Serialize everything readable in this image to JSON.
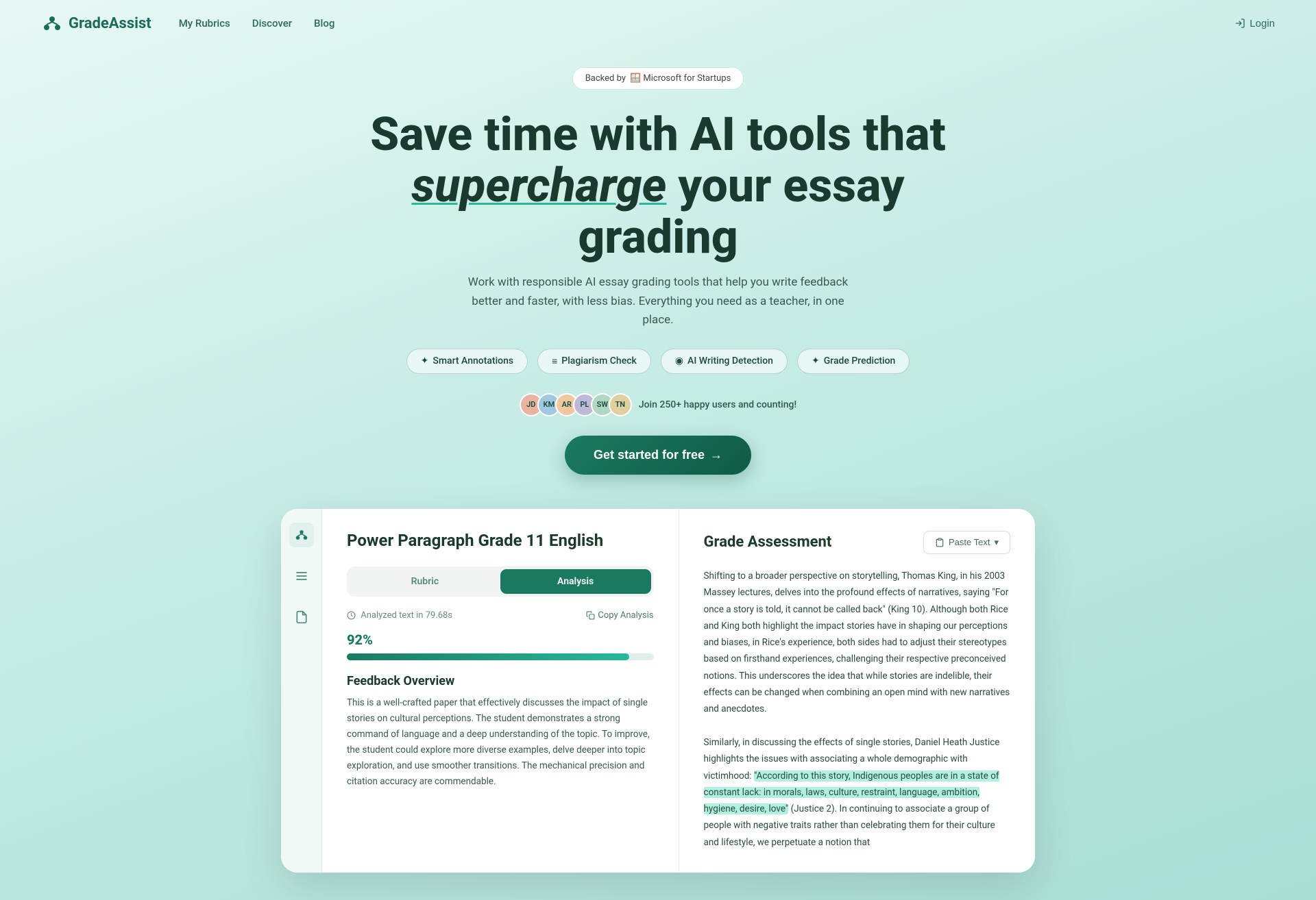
{
  "navbar": {
    "logo_text": "GradeAssist",
    "links": [
      "My Rubrics",
      "Discover",
      "Blog"
    ],
    "login_label": "Login"
  },
  "backed_badge": {
    "prefix": "Backed by",
    "company": "🪟 Microsoft for Startups"
  },
  "hero": {
    "title_line1": "Save time with AI tools that",
    "title_line2_italic": "supercharge",
    "title_line2_rest": " your essay grading",
    "subtitle": "Work with responsible AI essay grading tools that help you write feedback better and faster, with less bias. Everything you need as a teacher, in one place.",
    "cta_label": "Get started for free",
    "social_proof_text": "Join 250+ happy users and counting!"
  },
  "pills": [
    {
      "icon": "✦",
      "label": "Smart Annotations"
    },
    {
      "icon": "≡",
      "label": "Plagiarism Check"
    },
    {
      "icon": "◉",
      "label": "AI Writing Detection"
    },
    {
      "icon": "✦",
      "label": "Grade Prediction"
    }
  ],
  "avatars": [
    "JD",
    "KM",
    "AR",
    "PL",
    "SW",
    "TN"
  ],
  "demo": {
    "sidebar_icons": [
      "logo",
      "list",
      "file"
    ],
    "left": {
      "title": "Power Paragraph Grade 11 English",
      "tab_rubric": "Rubric",
      "tab_analysis": "Analysis",
      "analyzed_time": "Analyzed text in 79.68s",
      "copy_label": "Copy Analysis",
      "progress_pct": "92%",
      "progress_value": 92,
      "feedback_overview_title": "Feedback Overview",
      "feedback_text": "This is a well-crafted paper that effectively discusses the impact of single stories on cultural perceptions. The student demonstrates a strong command of language and a deep understanding of the topic. To improve, the student could explore more diverse examples, delve deeper into topic exploration, and use smoother transitions. The mechanical precision and citation accuracy are commendable."
    },
    "right": {
      "title": "Grade Assessment",
      "paste_btn": "Paste Text",
      "essay_part1": "Shifting to a broader perspective on storytelling, Thomas King, in his 2003 Massey lectures, delves into the profound effects of narratives, saying \"For once a story is told, it cannot be called back\" (King 10). Although both Rice and King both highlight the impact stories have in shaping our perceptions and biases, in Rice's experience, both sides had to adjust their stereotypes based on firsthand experiences, challenging their respective preconceived notions. This underscores the idea that while stories are indelible, their effects can be changed when combining an open mind with new narratives and anecdotes.",
      "essay_part2": "Similarly, in discussing the effects of single stories, Daniel Heath Justice highlights the issues with associating a whole demographic with victimhood: ",
      "essay_highlighted": "\"According to this story, Indigenous peoples are in a state of constant lack: in morals, laws, culture, restraint, language, ambition, hygiene, desire, love\"",
      "essay_part3": " (Justice 2). In continuing to associate a group of people with negative traits rather than celebrating them for their culture and lifestyle, we perpetuate a notion that"
    }
  }
}
